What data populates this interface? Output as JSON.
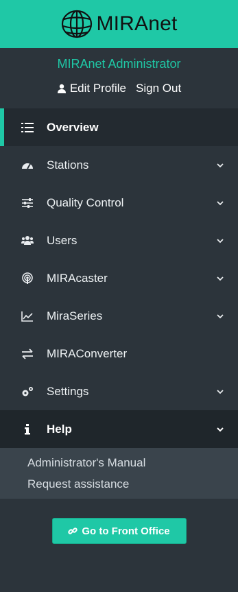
{
  "brand": {
    "name": "MIRAnet",
    "logo_icon": "globe-icon",
    "color": "#1fc8a6"
  },
  "user": {
    "name": "MIRAnet Administrator",
    "edit_profile": "Edit Profile",
    "sign_out": "Sign Out"
  },
  "nav": {
    "overview": "Overview",
    "stations": "Stations",
    "quality_control": "Quality Control",
    "users": "Users",
    "miracaster": "MIRAcaster",
    "miraseries": "MiraSeries",
    "miraconverter": "MIRAConverter",
    "settings": "Settings",
    "help": "Help"
  },
  "help_submenu": {
    "manual": "Administrator's Manual",
    "assistance": "Request assistance"
  },
  "footer": {
    "front_office": "Go to Front Office"
  },
  "colors": {
    "sidebar_bg": "#2c343b",
    "accent": "#1fc8a6",
    "active_bg": "#232a30",
    "submenu_bg": "#3a444c"
  }
}
